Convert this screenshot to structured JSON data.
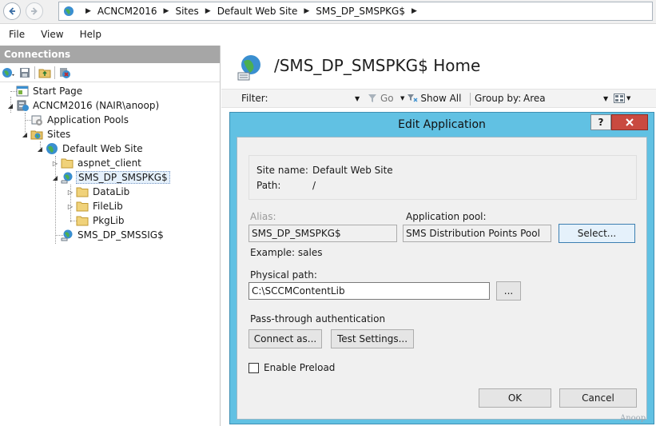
{
  "address_bar": {
    "crumbs": [
      "ACNCM2016",
      "Sites",
      "Default Web Site",
      "SMS_DP_SMSPKG$"
    ]
  },
  "menu": [
    "File",
    "View",
    "Help"
  ],
  "connections": {
    "header": "Connections",
    "tree": [
      {
        "label": "Start Page",
        "icon": "start-page-icon",
        "twisty": ""
      },
      {
        "label": "ACNCM2016 (NAIR\\anoop)",
        "icon": "server-icon",
        "twisty": "◢"
      },
      {
        "label": "Application Pools",
        "icon": "app-pools-icon",
        "twisty": ""
      },
      {
        "label": "Sites",
        "icon": "sites-icon",
        "twisty": "◢"
      },
      {
        "label": "Default Web Site",
        "icon": "globe-icon",
        "twisty": "◢"
      },
      {
        "label": "aspnet_client",
        "icon": "folder-icon",
        "twisty": "▷"
      },
      {
        "label": "SMS_DP_SMSPKG$",
        "icon": "application-icon",
        "twisty": "◢"
      },
      {
        "label": "DataLib",
        "icon": "folder-icon",
        "twisty": "▷"
      },
      {
        "label": "FileLib",
        "icon": "folder-icon",
        "twisty": "▷"
      },
      {
        "label": "PkgLib",
        "icon": "folder-icon",
        "twisty": ""
      },
      {
        "label": "SMS_DP_SMSSIG$",
        "icon": "application-icon",
        "twisty": ""
      }
    ]
  },
  "main": {
    "title": "/SMS_DP_SMSPKG$ Home",
    "filter_label": "Filter:",
    "go_label": "Go",
    "show_all_label": "Show All",
    "group_by_label": "Group by:",
    "group_by_value": "Area"
  },
  "dialog": {
    "title": "Edit Application",
    "help_label": "?",
    "site_name_label": "Site name:",
    "site_name_value": "Default Web Site",
    "path_label": "Path:",
    "path_value": "/",
    "alias_label": "Alias:",
    "alias_value": "SMS_DP_SMSPKG$",
    "app_pool_label": "Application pool:",
    "app_pool_value": "SMS Distribution Points Pool",
    "select_label": "Select...",
    "example_label": "Example: sales",
    "physical_path_label": "Physical path:",
    "physical_path_value": "C:\\SCCMContentLib",
    "browse_label": "...",
    "passthrough_label": "Pass-through authentication",
    "connect_as_label": "Connect as...",
    "test_settings_label": "Test Settings...",
    "enable_preload_label": "Enable Preload",
    "enable_preload_checked": false,
    "ok_label": "OK",
    "cancel_label": "Cancel"
  },
  "watermark": "Anoop",
  "colors": {
    "dialog_frame": "#61c1e3",
    "close_button": "#c94a40",
    "connections_header": "#a6a6a6"
  }
}
